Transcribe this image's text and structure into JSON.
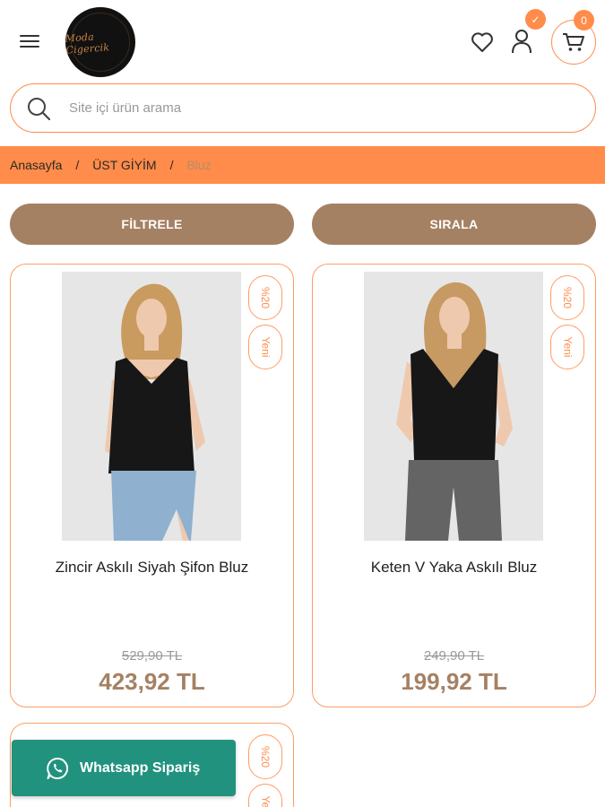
{
  "header": {
    "logo_text": "Moda Cigercik",
    "user_badge": "✓",
    "cart_count": "0"
  },
  "search": {
    "placeholder": "Site içi ürün arama"
  },
  "breadcrumb": {
    "items": [
      "Anasayfa",
      "ÜST GİYİM",
      "Bluz"
    ],
    "separator": "/"
  },
  "actions": {
    "filter_label": "FİLTRELE",
    "sort_label": "SIRALA"
  },
  "products": [
    {
      "name": "Zincir Askılı Siyah Şifon Bluz",
      "old_price": "529,90 TL",
      "new_price": "423,92 TL",
      "discount_tag": "%20",
      "new_tag": "Yeni"
    },
    {
      "name": "Keten V Yaka Askılı Bluz",
      "old_price": "249,90 TL",
      "new_price": "199,92 TL",
      "discount_tag": "%20",
      "new_tag": "Yeni"
    },
    {
      "discount_tag": "%20",
      "new_tag": "Yeni"
    }
  ],
  "whatsapp": {
    "label": "Whatsapp Sipariş"
  },
  "colors": {
    "accent": "#ff8c4a",
    "button": "#a58163",
    "whatsapp": "#21927d"
  }
}
